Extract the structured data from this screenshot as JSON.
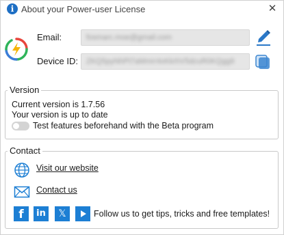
{
  "window": {
    "title": "About your Power-user License",
    "close_symbol": "✕"
  },
  "account": {
    "email_label": "Email:",
    "email_value": "fosmarc.moe@gmail.com",
    "device_label": "Device ID:",
    "device_value": "ZKQ5pyNhPt7aMmrr4xKkrhV5dcuR0KQgg9"
  },
  "version": {
    "title": "Version",
    "current": "Current version is 1.7.56",
    "status": "Your version is up to date",
    "beta_label": "Test features beforehand with the Beta program",
    "beta_enabled": false
  },
  "contact": {
    "title": "Contact",
    "website_label": "Visit our website",
    "contact_label": "Contact us",
    "social_text": "Follow us to get tips, tricks and free templates!",
    "social_icons": [
      "facebook-icon",
      "linkedin-icon",
      "x-icon",
      "youtube-icon"
    ]
  },
  "colors": {
    "accent_blue": "#1d7fd4",
    "logo_red": "#e8453c",
    "logo_yellow": "#f5b400",
    "logo_green": "#2fb45a",
    "logo_blue": "#3b7dd8"
  }
}
